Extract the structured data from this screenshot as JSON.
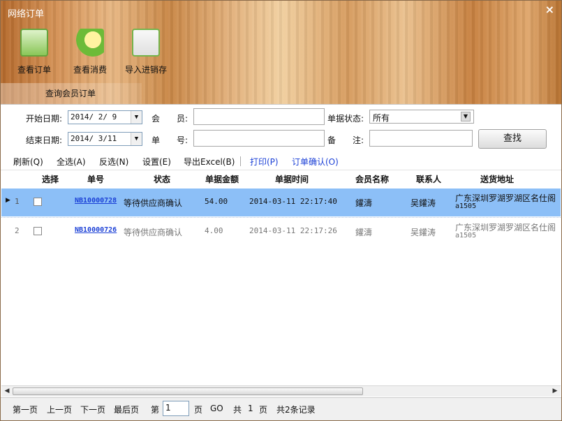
{
  "window": {
    "title": "网络订单",
    "close": "×"
  },
  "toolbar": {
    "buttons": [
      {
        "label": "查看订单",
        "icon": "magnifier-icon"
      },
      {
        "label": "查看消费",
        "icon": "money-search-icon"
      },
      {
        "label": "导入进销存",
        "icon": "chart-import-icon"
      }
    ],
    "group_caption": "查询会员订单"
  },
  "filters": {
    "start_label": "开始日期:",
    "start_value": "2014/ 2/ 9",
    "end_label": "结束日期:",
    "end_value": "2014/ 3/11",
    "member_label_a": "会",
    "member_label_b": "员:",
    "order_no_label_a": "单",
    "order_no_label_b": "号:",
    "status_label": "单据状态:",
    "status_value": "所有",
    "remark_label_a": "备",
    "remark_label_b": "注:",
    "search_label": "查找"
  },
  "actions": {
    "refresh": "刷新(Q)",
    "select_all": "全选(A)",
    "invert": "反选(N)",
    "settings": "设置(E)",
    "export_excel": "导出Excel(B)",
    "print": "打印(P)",
    "confirm_order": "订单确认(O)"
  },
  "grid": {
    "columns": [
      "选择",
      "单号",
      "状态",
      "单据金额",
      "单据时间",
      "会员名称",
      "联系人",
      "送货地址"
    ],
    "rows": [
      {
        "index": "1",
        "order_no": "NB10000728",
        "status": "等待供应商确认",
        "amount": "54.00",
        "time": "2014-03-11 22:17:40",
        "member": "鑵濤",
        "contact": "吴鑵涛",
        "address_line1": "广东深圳罗湖罗湖区名仕阁",
        "address_line2": "a1505"
      },
      {
        "index": "2",
        "order_no": "NB10000726",
        "status": "等待供应商确认",
        "amount": "4.00",
        "time": "2014-03-11 22:17:26",
        "member": "鑵濤",
        "contact": "吴鑵涛",
        "address_line1": "广东深圳罗湖罗湖区名仕阁",
        "address_line2": "a1505"
      }
    ]
  },
  "pager": {
    "first": "第一页",
    "prev": "上一页",
    "next": "下一页",
    "last": "最后页",
    "page_prefix": "第",
    "page_value": "1",
    "page_suffix": "页",
    "go": "GO",
    "total_prefix": "共",
    "total_pages": "1",
    "total_suffix": "页",
    "record_count": "共2条记录"
  }
}
